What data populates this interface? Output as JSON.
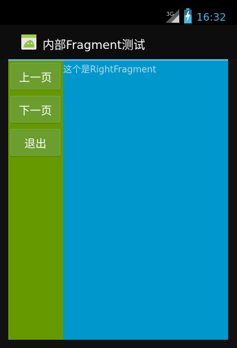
{
  "status_bar": {
    "network": "3G",
    "time": "16:32",
    "signal_icon": "signal-icon",
    "battery_icon": "battery-charging-icon"
  },
  "action_bar": {
    "title": "内部Fragment测试",
    "icon": "android-app-icon"
  },
  "left_fragment": {
    "buttons": [
      {
        "label": "上一页"
      },
      {
        "label": "下一页"
      },
      {
        "label": "退出"
      }
    ]
  },
  "right_fragment": {
    "text": "这个是RightFragment"
  },
  "colors": {
    "left_pane": "#669900",
    "right_pane": "#0098cc",
    "clock": "#42b8e6"
  }
}
